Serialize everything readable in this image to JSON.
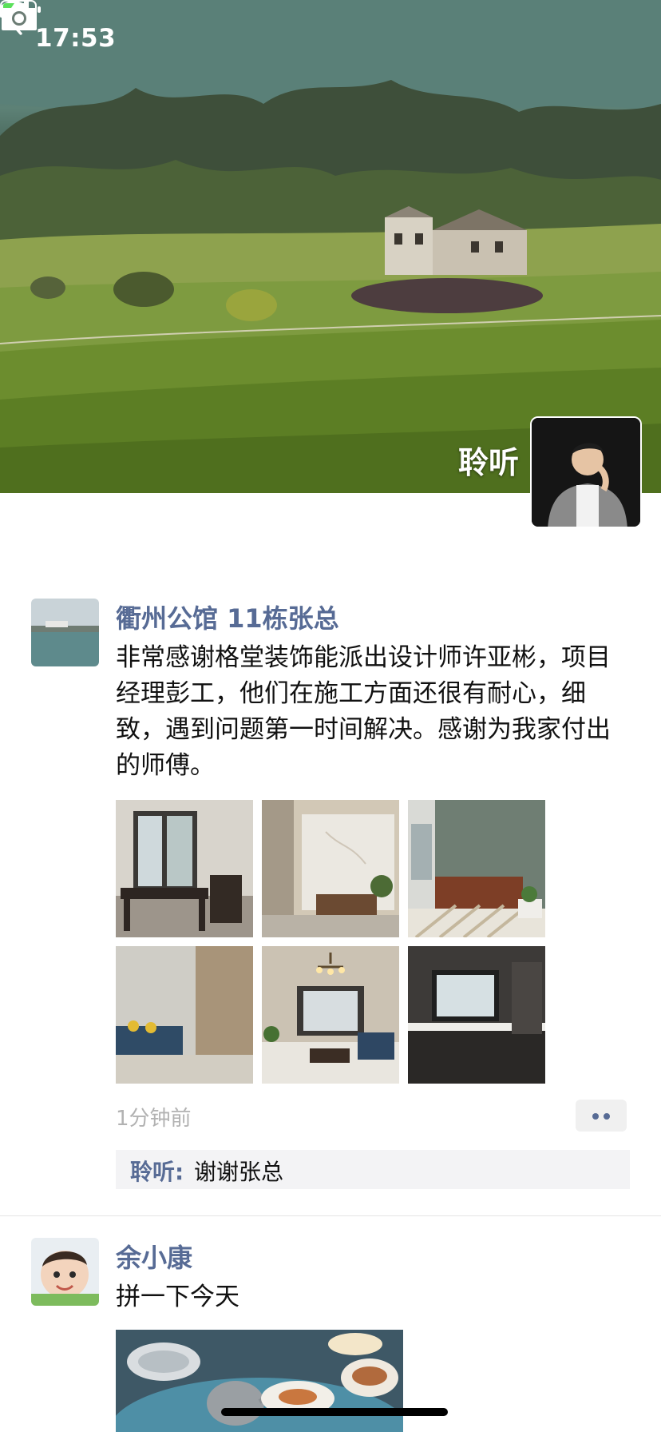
{
  "status_bar": {
    "time": "17:53"
  },
  "nav": {
    "back_icon": "chevron-left-icon",
    "camera_icon": "camera-icon"
  },
  "profile": {
    "name": "聆听"
  },
  "posts": [
    {
      "author": "衢州公馆 11栋张总",
      "text": "非常感谢格堂装饰能派出设计师许亚彬，项目经理彭工，他们在施工方面还很有耐心，细致，遇到问题第一时间解决。感谢为我家付出的师傅。",
      "photo_count": 6,
      "time": "1分钟前",
      "comments": [
        {
          "author": "聆听",
          "separator": ": ",
          "text": "谢谢张总"
        }
      ]
    },
    {
      "author": "余小康",
      "text": "拼一下今天"
    }
  ],
  "colors": {
    "link": "#576b95",
    "time": "#b2b2b2",
    "comment_bg": "#f3f3f5"
  }
}
